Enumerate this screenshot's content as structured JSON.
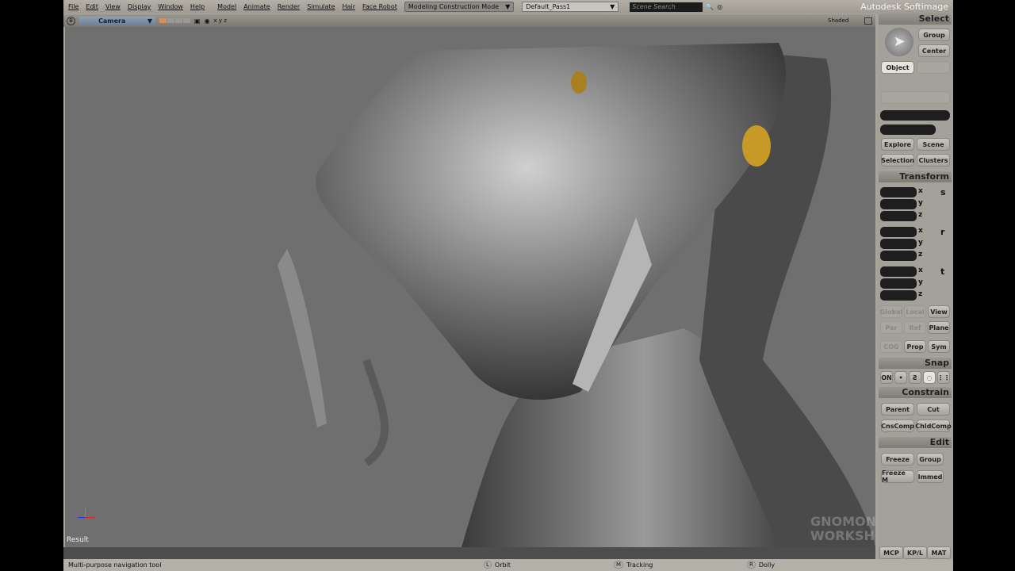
{
  "menu": [
    "File",
    "Edit",
    "View",
    "Display",
    "Window",
    "Help"
  ],
  "modules": [
    "Model",
    "Animate",
    "Render",
    "Simulate",
    "Hair",
    "Face Robot"
  ],
  "mode": "Modeling Construction Mode",
  "pass": "Default_Pass1",
  "search_placeholder": "Scene Search",
  "brand": "Autodesk Softimage",
  "viewport": {
    "camera": "Camera",
    "axes": "x y z",
    "display_mode": "Shaded",
    "result_label": "Result",
    "watermark": "GNOMON WORKSHOP"
  },
  "status": {
    "hint": "Multi-purpose navigation tool",
    "L": "Orbit",
    "M": "Tracking",
    "R": "Dolly",
    "l_key": "L",
    "m_key": "M",
    "r_key": "R"
  },
  "panel": {
    "select": {
      "title": "Select",
      "group": "Group",
      "center": "Center",
      "object": "Object",
      "explore": "Explore",
      "scene": "Scene",
      "selection": "Selection",
      "clusters": "Clusters"
    },
    "transform": {
      "title": "Transform",
      "x": "x",
      "y": "y",
      "z": "z",
      "s": "s",
      "r": "r",
      "t": "t",
      "global": "Global",
      "local": "Local",
      "view": "View",
      "par": "Par",
      "ref": "Ref",
      "plane": "Plane",
      "cog": "COG",
      "prop": "Prop",
      "sym": "Sym"
    },
    "snap": {
      "title": "Snap",
      "on": "ON"
    },
    "constrain": {
      "title": "Constrain",
      "parent": "Parent",
      "cut": "Cut",
      "cnscomp": "CnsComp",
      "childcomp": "ChldComp"
    },
    "edit": {
      "title": "Edit",
      "freeze": "Freeze",
      "group": "Group",
      "freezem": "Freeze M",
      "immed": "Immed"
    },
    "tabs": [
      "MCP",
      "KP/L",
      "MAT"
    ]
  }
}
